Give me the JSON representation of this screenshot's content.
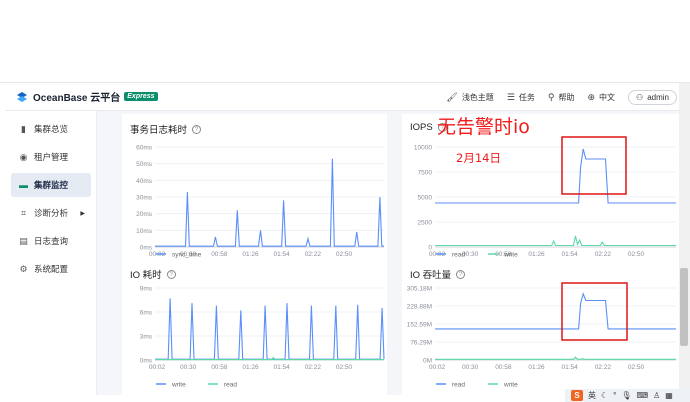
{
  "header": {
    "logo_text": "OceanBase 云平台",
    "badge": "Express",
    "items": [
      {
        "icon": "paint-icon",
        "label": "浅色主题"
      },
      {
        "icon": "list-icon",
        "label": "任务"
      },
      {
        "icon": "help-icon",
        "label": "帮助"
      },
      {
        "icon": "globe-icon",
        "label": "中文"
      }
    ],
    "user": "admin"
  },
  "sidebar": {
    "items": [
      {
        "icon": "bar-chart-icon",
        "label": "集群总览",
        "active": false
      },
      {
        "icon": "tenant-icon",
        "label": "租户管理",
        "active": false
      },
      {
        "icon": "monitor-icon",
        "label": "集群监控",
        "active": true
      },
      {
        "icon": "diagnose-icon",
        "label": "诊断分析",
        "active": false,
        "has_submenu": true
      },
      {
        "icon": "log-icon",
        "label": "日志查询",
        "active": false
      },
      {
        "icon": "settings-icon",
        "label": "系统配置",
        "active": false
      }
    ]
  },
  "annotation": {
    "title": "无告警时io",
    "date": "2月14日"
  },
  "taskbar": {
    "ime_icon": "S",
    "ime_lang": "英"
  },
  "colors": {
    "series_blue": "#5b8ff9",
    "series_green": "#5ad8a6",
    "annotation_red": "#f21b1b",
    "badge_green": "#0a8f6a"
  },
  "chart_data": [
    {
      "id": "tx-log-time",
      "type": "line",
      "title": "事务日志耗时",
      "x_ticks": [
        "00:02",
        "00:30",
        "00:58",
        "01:26",
        "01:54",
        "02:22",
        "02:50"
      ],
      "y_ticks": [
        "0ms",
        "10ms",
        "20ms",
        "30ms",
        "40ms",
        "50ms",
        "60ms"
      ],
      "ylim": [
        0,
        60
      ],
      "series": [
        {
          "name": "sync_time",
          "color": "#5b8ff9",
          "points": [
            [
              0,
              0.5
            ],
            [
              12.5,
              0.5
            ],
            [
              13.3,
              33
            ],
            [
              14.1,
              0.5
            ],
            [
              24,
              0.5
            ],
            [
              24.8,
              6
            ],
            [
              25.6,
              0.5
            ],
            [
              33,
              0.5
            ],
            [
              33.8,
              22
            ],
            [
              34.6,
              0.5
            ],
            [
              42.5,
              0.5
            ],
            [
              43.3,
              10
            ],
            [
              44.1,
              0.5
            ],
            [
              52,
              0.5
            ],
            [
              52.8,
              28
            ],
            [
              53.6,
              0.5
            ],
            [
              62,
              0.5
            ],
            [
              62.8,
              5
            ],
            [
              63.6,
              0.5
            ],
            [
              72,
              0.5
            ],
            [
              72.8,
              53
            ],
            [
              73.6,
              0.5
            ],
            [
              82,
              0.5
            ],
            [
              82.8,
              9
            ],
            [
              83.6,
              0.5
            ],
            [
              91.5,
              0.5
            ],
            [
              92.3,
              30
            ],
            [
              93.1,
              0.5
            ],
            [
              94,
              0.5
            ]
          ]
        }
      ]
    },
    {
      "id": "iops",
      "type": "line",
      "title": "IOPS",
      "x_ticks": [
        "00:02",
        "00:30",
        "00:58",
        "01:26",
        "01:54",
        "02:22",
        "02:50"
      ],
      "y_ticks": [
        "0",
        "2500",
        "5000",
        "7500",
        "10000"
      ],
      "ylim": [
        0,
        10000
      ],
      "series": [
        {
          "name": "read",
          "color": "#5b8ff9",
          "points": [
            [
              0,
              4400
            ],
            [
              56,
              4400
            ],
            [
              56.8,
              8000
            ],
            [
              57.8,
              9800
            ],
            [
              58.8,
              8800
            ],
            [
              66.5,
              8800
            ],
            [
              67.5,
              4400
            ],
            [
              94,
              4400
            ]
          ]
        },
        {
          "name": "write",
          "color": "#5ad8a6",
          "points": [
            [
              0,
              150
            ],
            [
              45.5,
              150
            ],
            [
              46.3,
              600
            ],
            [
              47,
              150
            ],
            [
              54,
              150
            ],
            [
              54.8,
              1100
            ],
            [
              55.6,
              250
            ],
            [
              56.4,
              700
            ],
            [
              57.2,
              150
            ],
            [
              64.5,
              150
            ],
            [
              65.2,
              500
            ],
            [
              66,
              150
            ],
            [
              94,
              150
            ]
          ]
        }
      ]
    },
    {
      "id": "io-time",
      "type": "line",
      "title": "IO 耗时",
      "x_ticks": [
        "00:02",
        "00:30",
        "00:58",
        "01:26",
        "01:54",
        "02:22",
        "02:50"
      ],
      "y_ticks": [
        "0ms",
        "3ms",
        "6ms",
        "9ms"
      ],
      "ylim": [
        0,
        9
      ],
      "series": [
        {
          "name": "write",
          "color": "#5b8ff9",
          "points": [
            [
              0,
              0.1
            ],
            [
              5.4,
              0.1
            ],
            [
              6.2,
              7.7
            ],
            [
              7,
              0.1
            ],
            [
              14.4,
              0.1
            ],
            [
              15.2,
              7.1
            ],
            [
              16,
              0.1
            ],
            [
              24.4,
              0.1
            ],
            [
              25.2,
              6.8
            ],
            [
              26,
              0.1
            ],
            [
              34.4,
              0.1
            ],
            [
              35.2,
              6.2
            ],
            [
              36,
              0.1
            ],
            [
              44.4,
              0.1
            ],
            [
              45.2,
              6.8
            ],
            [
              46,
              0.1
            ],
            [
              53.4,
              0.1
            ],
            [
              54.2,
              7.1
            ],
            [
              55,
              0.1
            ],
            [
              63.4,
              0.1
            ],
            [
              64.2,
              6.8
            ],
            [
              65,
              0.1
            ],
            [
              73.4,
              0.1
            ],
            [
              74.2,
              6.8
            ],
            [
              75,
              0.1
            ],
            [
              82.4,
              0.1
            ],
            [
              83.2,
              6.9
            ],
            [
              84,
              0.1
            ],
            [
              92.4,
              0.1
            ],
            [
              93.2,
              6.5
            ],
            [
              94,
              0.1
            ]
          ]
        },
        {
          "name": "read",
          "color": "#5ad8a6",
          "points": [
            [
              0,
              0.05
            ],
            [
              48,
              0.05
            ],
            [
              48.6,
              0.3
            ],
            [
              49.2,
              0.05
            ],
            [
              94,
              0.05
            ]
          ]
        }
      ]
    },
    {
      "id": "io-throughput",
      "type": "line",
      "title": "IO 吞吐量",
      "x_ticks": [
        "00:02",
        "00:30",
        "00:58",
        "01:26",
        "01:54",
        "02:22",
        "02:50"
      ],
      "y_ticks": [
        "0M",
        "76.29M",
        "152.59M",
        "228.88M",
        "305.18M"
      ],
      "ylim": [
        0,
        305.18
      ],
      "series": [
        {
          "name": "read",
          "color": "#5b8ff9",
          "points": [
            [
              0,
              132
            ],
            [
              56,
              132
            ],
            [
              56.8,
              240
            ],
            [
              57.8,
              280
            ],
            [
              58.8,
              252
            ],
            [
              66.5,
              252
            ],
            [
              67.5,
              132
            ],
            [
              94,
              132
            ]
          ]
        },
        {
          "name": "write",
          "color": "#5ad8a6",
          "points": [
            [
              0,
              3
            ],
            [
              54,
              3
            ],
            [
              54.8,
              12
            ],
            [
              55.6,
              3
            ],
            [
              57,
              3
            ],
            [
              57.6,
              6
            ],
            [
              58.2,
              3
            ],
            [
              94,
              3
            ]
          ]
        }
      ]
    }
  ]
}
